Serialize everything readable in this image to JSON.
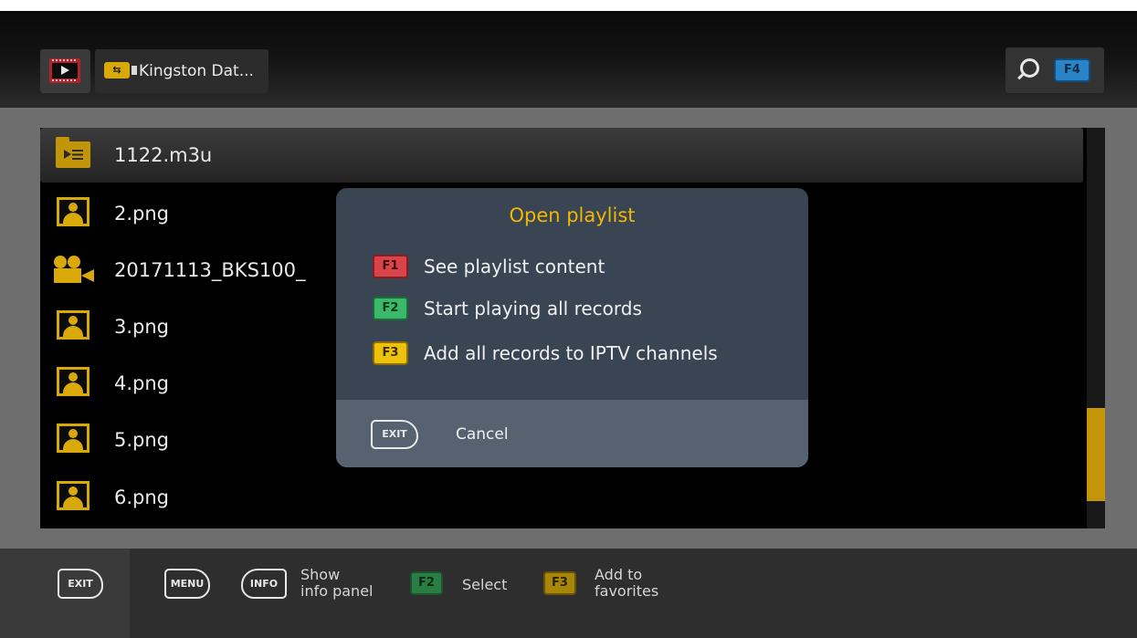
{
  "header": {
    "path_label": "Kingston Dat...",
    "usb_symbol": "⇆",
    "search_key": "F4"
  },
  "file_list": {
    "items": [
      {
        "name": "1122.m3u",
        "type": "playlist",
        "selected": true
      },
      {
        "name": "2.png",
        "type": "image"
      },
      {
        "name": "20171113_BKS100_",
        "type": "video"
      },
      {
        "name": "3.png",
        "type": "image"
      },
      {
        "name": "4.png",
        "type": "image"
      },
      {
        "name": "5.png",
        "type": "image"
      },
      {
        "name": "6.png",
        "type": "image"
      }
    ]
  },
  "dialog": {
    "title": "Open playlist",
    "options": [
      {
        "key": "F1",
        "label": "See playlist content",
        "color": "#d9434a"
      },
      {
        "key": "F2",
        "label": "Start playing all records",
        "color": "#3cb86a"
      },
      {
        "key": "F3",
        "label": "Add all records to IPTV channels",
        "color": "#ecc20d"
      }
    ],
    "exit_key": "EXIT",
    "cancel_label": "Cancel"
  },
  "bottom_bar": {
    "exit_key": "EXIT",
    "menu_key": "MENU",
    "info_key": "INFO",
    "info_line1": "Show",
    "info_line2": "info panel",
    "select_key": "F2",
    "select_label": "Select",
    "fav_key": "F3",
    "fav_line1": "Add to",
    "fav_line2": "favorites"
  },
  "colors": {
    "accent": "#f2b705",
    "icon_gold": "#d9a90a",
    "dialog_bg": "#394552"
  }
}
